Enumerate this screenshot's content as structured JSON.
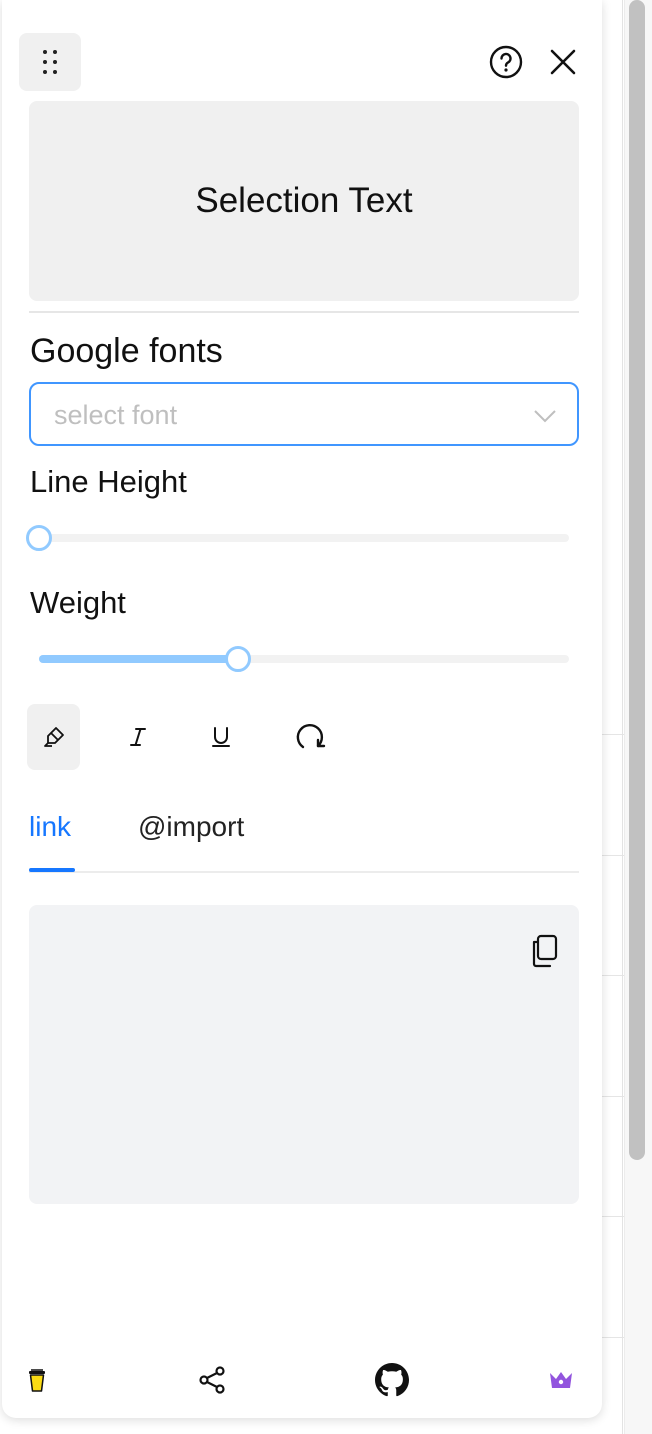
{
  "preview": {
    "text": "Selection Text"
  },
  "fonts": {
    "label": "Google fonts",
    "placeholder": "select font"
  },
  "line_height": {
    "label": "Line Height",
    "value_fraction": 0.0
  },
  "weight": {
    "label": "Weight",
    "value_fraction": 0.375
  },
  "toolbar": [
    {
      "icon": "highlighter-icon",
      "active": true
    },
    {
      "icon": "italic-icon",
      "active": false
    },
    {
      "icon": "underline-icon",
      "active": false
    },
    {
      "icon": "reset-icon",
      "active": false
    }
  ],
  "tabs": [
    {
      "label": "link",
      "active": true
    },
    {
      "label": "@import",
      "active": false
    }
  ],
  "header_icons": [
    "drag-handle-icon",
    "help-icon",
    "close-icon"
  ],
  "code_box_icon": "copy-icon",
  "footer_icons": [
    "coffee-cup-icon",
    "share-icon",
    "github-icon",
    "crown-icon"
  ],
  "colors": {
    "accent": "#1677ff",
    "slider": "#91caff",
    "crown": "#9254de",
    "coffee": "#fadb14"
  }
}
